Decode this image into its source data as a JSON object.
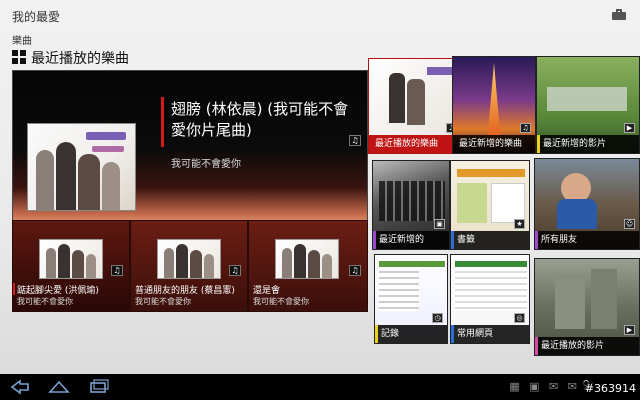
{
  "header": {
    "title": "我的最愛",
    "menu_icon": "briefcase-icon"
  },
  "breadcrumb": "樂曲",
  "section": {
    "icon": "grid-icon",
    "title": "最近播放的樂曲"
  },
  "now_playing": {
    "title": "翅膀 (林依晨) (我可能不會愛你片尾曲)",
    "album": "我可能不會愛你",
    "icon": "music-note-icon",
    "accent": "#d41a1a"
  },
  "tracks": [
    {
      "title": "踮起腳尖愛 (洪佩瑜)",
      "album": "我可能不會愛你"
    },
    {
      "title": "普通朋友的朋友 (蔡昌憲)",
      "album": "我可能不會愛你"
    },
    {
      "title": "還是會",
      "album": "我可能不會愛你"
    }
  ],
  "tiles": [
    {
      "label": "最近播放的樂曲",
      "icon": "music-note-icon"
    },
    {
      "label": "最近新增的樂曲",
      "icon": "music-note-icon"
    },
    {
      "label": "最近新增的影片",
      "icon": "video-icon"
    },
    {
      "label": "最近新增的",
      "icon": "image-icon"
    },
    {
      "label": "書籤",
      "icon": "bookmark-icon"
    },
    {
      "label": "所有朋友",
      "icon": "people-icon"
    },
    {
      "label": "記錄",
      "icon": "history-icon"
    },
    {
      "label": "常用網頁",
      "icon": "globe-icon"
    },
    {
      "label": "最近播放的影片",
      "icon": "video-icon"
    }
  ],
  "status_bar": {
    "indicators": "▦ ▣ ✉ ✉",
    "time": "9:",
    "watermark": "#363914"
  }
}
